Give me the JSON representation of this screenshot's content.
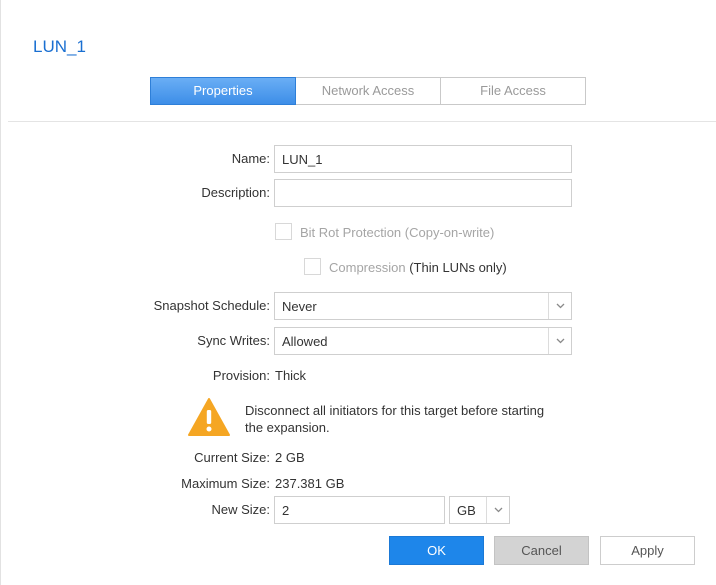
{
  "title": "LUN_1",
  "tabs": [
    {
      "label": "Properties",
      "active": true
    },
    {
      "label": "Network Access",
      "active": false
    },
    {
      "label": "File Access",
      "active": false
    }
  ],
  "form": {
    "name_label": "Name:",
    "name_value": "LUN_1",
    "description_label": "Description:",
    "description_value": "",
    "bitrot_label": "Bit Rot Protection (Copy-on-write)",
    "bitrot_checked": false,
    "compression_label": "Compression",
    "compression_note": "(Thin LUNs only)",
    "compression_checked": false,
    "snapshot_label": "Snapshot Schedule:",
    "snapshot_value": "Never",
    "sync_label": "Sync Writes:",
    "sync_value": "Allowed",
    "provision_label": "Provision:",
    "provision_value": "Thick",
    "warning_text": "Disconnect all initiators for this target before starting the expansion.",
    "current_size_label": "Current Size:",
    "current_size_value": "2 GB",
    "max_size_label": "Maximum Size:",
    "max_size_value": "237.381 GB",
    "new_size_label": "New Size:",
    "new_size_value": "2",
    "new_size_unit": "GB"
  },
  "buttons": {
    "ok": "OK",
    "cancel": "Cancel",
    "apply": "Apply"
  },
  "colors": {
    "accent": "#1e86ea",
    "title": "#1a6fd1",
    "warning": "#f5a623"
  },
  "icons": {
    "warning": "warning-icon",
    "dropdown": "chevron-down-icon"
  }
}
